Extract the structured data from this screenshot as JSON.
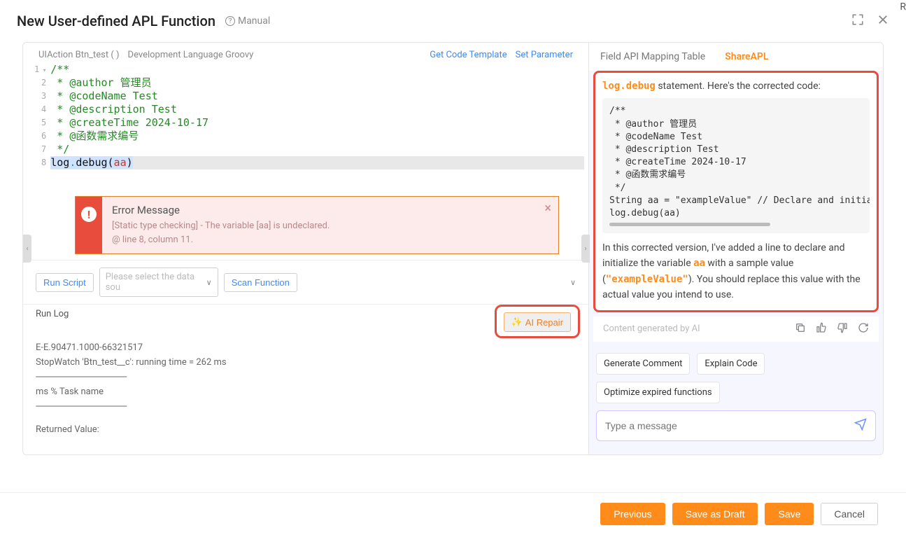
{
  "header": {
    "title": "New User-defined APL Function",
    "manual_label": "Manual"
  },
  "meta": {
    "uiaction": "UIAction Btn_test ( )",
    "dev_lang": "Development Language Groovy",
    "get_template": "Get Code Template",
    "set_param": "Set Parameter"
  },
  "editor_lines": [
    "/**",
    " * @author 管理员",
    " * @codeName Test",
    " * @description Test",
    " * @createTime 2024-10-17",
    " * @函数需求编号",
    " */"
  ],
  "editor_hl_prefix": "log",
  "editor_hl_dot": ".",
  "editor_hl_method": "debug(",
  "editor_hl_var": "aa",
  "editor_hl_close": ")",
  "error": {
    "title": "Error Message",
    "line1": "[Static type checking] - The variable [aa] is undeclared.",
    "line2": "@ line 8, column 11."
  },
  "toolbar": {
    "run_script": "Run Script",
    "select_placeholder": "Please select the data sou",
    "scan_function": "Scan Function"
  },
  "runlog": {
    "title": "Run Log",
    "ai_repair": "AI Repair",
    "lines": [
      "E-E.90471.1000-66321517",
      "StopWatch 'Btn_test__c': running time = 262 ms",
      "--------------------------------------------------",
      "ms % Task name",
      "--------------------------------------------------"
    ],
    "returned": "Returned Value:"
  },
  "right": {
    "tab1": "Field API Mapping Table",
    "tab2": "ShareAPL",
    "intro_prefix": "log.debug",
    "intro_rest": " statement. Here's the corrected code:",
    "codebox": "/**\n * @author 管理员\n * @codeName Test\n * @description Test\n * @createTime 2024-10-17\n * @函数需求编号\n */\nString aa = \"exampleValue\" // Declare and initial\nlog.debug(aa)",
    "expl_1": "In this corrected version, I've added a line to declare and initialize the variable ",
    "expl_var": "aa",
    "expl_2": " with a sample value (",
    "expl_val": "\"exampleValue\"",
    "expl_3": "). You should replace this value with the actual value you intend to use.",
    "ai_gen": "Content generated by AI",
    "suggest1": "Generate Comment",
    "suggest2": "Explain Code",
    "suggest3": "Optimize expired functions",
    "chat_placeholder": "Type a message"
  },
  "footer": {
    "previous": "Previous",
    "save_draft": "Save as Draft",
    "save": "Save",
    "cancel": "Cancel"
  },
  "cut_letter": "R"
}
